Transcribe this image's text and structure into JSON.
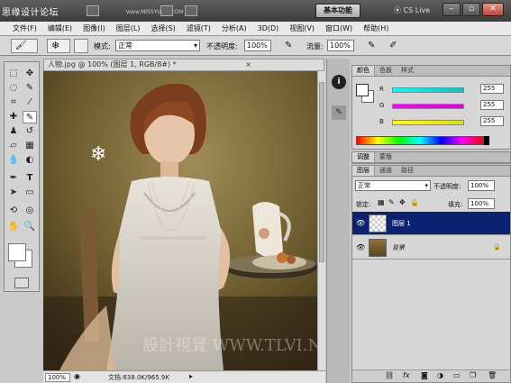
{
  "watermark_top": "思缘设计论坛",
  "watermark_top_url": "www.MISSYUAN.COM",
  "workspace_button": "基本功能",
  "cs_live": "CS Live",
  "window_controls": {
    "minimize": "–",
    "restore": "▫",
    "close": "✕"
  },
  "menu": [
    "文件(F)",
    "编辑(E)",
    "图像(I)",
    "图层(L)",
    "选择(S)",
    "滤镜(T)",
    "分析(A)",
    "3D(D)",
    "视图(V)",
    "窗口(W)",
    "帮助(H)"
  ],
  "options": {
    "mode_label": "模式:",
    "mode_value": "正常",
    "opacity_label": "不透明度:",
    "opacity_value": "100%",
    "flow_label": "流量:",
    "flow_value": "100%"
  },
  "document": {
    "tab_title": "人物.jpg @ 100% (图层 1, RGB/8#) *",
    "close": "×",
    "zoom": "100%",
    "doc_size": "文档:838.0K/965.9K",
    "watermark": "設計視覺 WWW.TLVI.NET"
  },
  "color_panel": {
    "tabs": [
      "颜色",
      "色板",
      "样式"
    ],
    "channels": [
      {
        "label": "R",
        "value": "255",
        "color": "#00c8c8"
      },
      {
        "label": "G",
        "value": "255",
        "color": "#e000e0"
      },
      {
        "label": "B",
        "value": "255",
        "color": "#e0e000"
      }
    ]
  },
  "adjust_panel": {
    "tabs": [
      "调整",
      "蒙版"
    ]
  },
  "layers_panel": {
    "tabs": [
      "图层",
      "通道",
      "路径"
    ],
    "blend_mode": "正常",
    "opacity_label": "不透明度:",
    "opacity_value": "100%",
    "lock_label": "锁定:",
    "fill_label": "填充:",
    "fill_value": "100%",
    "layers": [
      {
        "name": "图层 1",
        "selected": true,
        "locked": false
      },
      {
        "name": "背景",
        "selected": false,
        "locked": true
      }
    ],
    "footer_icons": [
      "link-icon",
      "fx-icon",
      "mask-icon",
      "adjustment-icon",
      "folder-icon",
      "new-layer-icon",
      "trash-icon"
    ]
  },
  "colors": {
    "selected_layer": "#0a2270",
    "canvas_bg": "#6f6034"
  }
}
